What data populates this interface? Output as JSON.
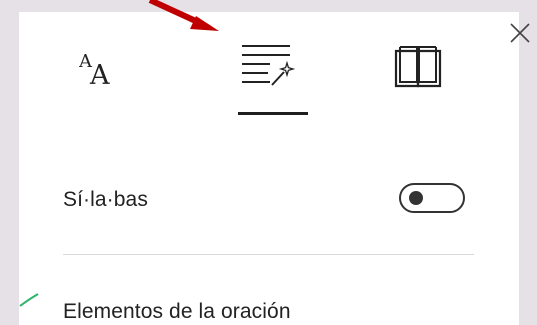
{
  "panel": {
    "tabs": [
      {
        "icon": "text-size-icon",
        "selected": false
      },
      {
        "icon": "grammar-options-icon",
        "selected": true
      },
      {
        "icon": "reading-preferences-icon",
        "selected": false
      }
    ],
    "close_icon": "close-icon"
  },
  "options": {
    "syllables": {
      "label": "Sí·la·bas",
      "enabled": false
    },
    "parts_of_speech": {
      "label": "Elementos de la oración"
    }
  },
  "annotations": {
    "arrow_color": "#c00000",
    "line_color": "#2eb36a"
  }
}
